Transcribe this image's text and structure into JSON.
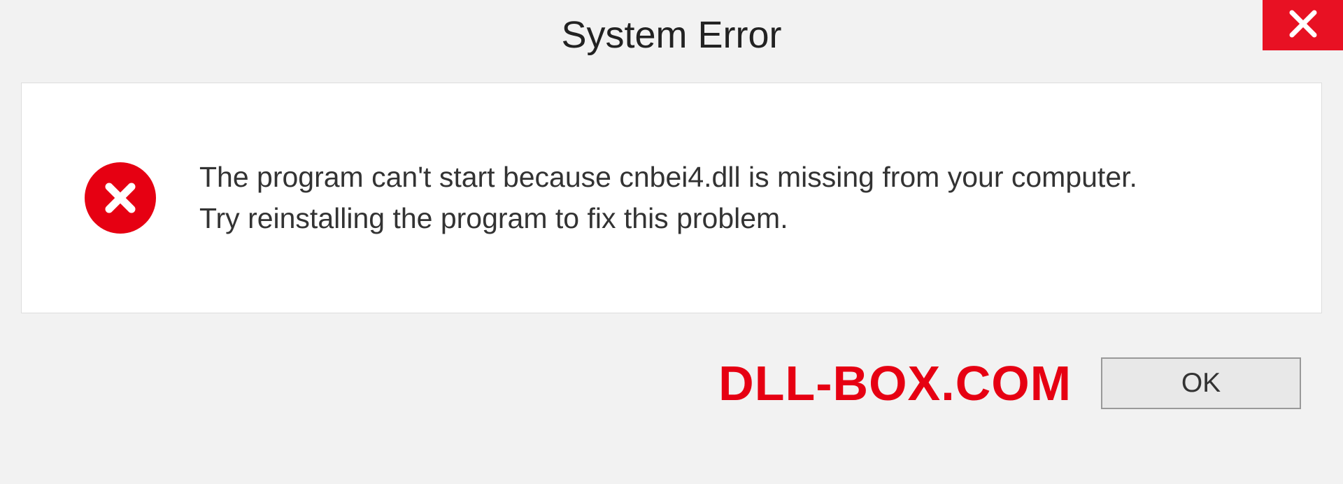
{
  "dialog": {
    "title": "System Error",
    "message_line1": "The program can't start because cnbei4.dll is missing from your computer.",
    "message_line2": "Try reinstalling the program to fix this problem.",
    "ok_label": "OK"
  },
  "watermark": "DLL-BOX.COM",
  "colors": {
    "close_bg": "#e81123",
    "error_icon_bg": "#e60012",
    "watermark_color": "#e60012"
  }
}
